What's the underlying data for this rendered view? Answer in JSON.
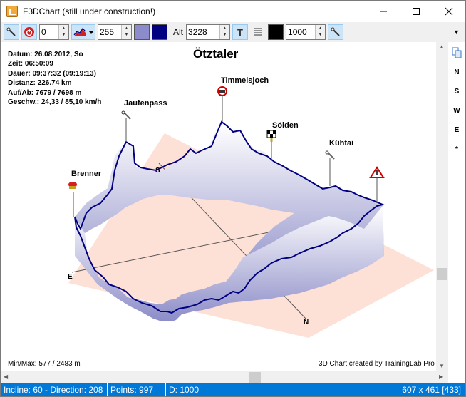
{
  "window": {
    "title": "F3DChart (still under construction!)",
    "minimize_icon": "minimize-icon",
    "maximize_icon": "maximize-icon",
    "close_icon": "close-icon"
  },
  "toolbar": {
    "button1_icon": "pointer-tool-icon",
    "button2_icon": "power-icon",
    "spin1_value": "0",
    "button3_icon": "line-chart-icon",
    "spin2_value": "255",
    "swatch1_color": "#8c8ccd",
    "swatch2_color": "#000080",
    "alt_label": "Alt",
    "spin3_value": "3228",
    "text_icon": "text-T-icon",
    "align_icon": "align-lines-icon",
    "swatch3_color": "#000000",
    "spin4_value": "1000",
    "button4_icon": "pointer-tool-icon"
  },
  "chart": {
    "title": "Ötztaler",
    "info": [
      "Datum: 26.08.2012, So",
      "Zeit: 06:50:09",
      "Dauer: 09:37:32 (09:19:13)",
      "Distanz: 226.74 km",
      "Auf/Ab: 7679 / 7698 m",
      "Geschw.: 24,33 / 85,10 km/h"
    ],
    "peaks": [
      "Timmelsjoch",
      "Jaufenpass",
      "Sölden",
      "Kühtai",
      "Brenner"
    ],
    "axis_labels": {
      "s": "S",
      "e": "E",
      "n": "N"
    },
    "minmax": "Min/Max: 577 / 2483 m",
    "credit": "3D Chart created by TrainingLab Pro",
    "ground_color": "#fde0d6",
    "line_color": "#000080"
  },
  "right_panel": {
    "copy_icon": "copy-icon",
    "items": [
      "N",
      "S",
      "W",
      "E",
      "*"
    ]
  },
  "statusbar": {
    "incline": "Incline: 60 - Direction: 208",
    "points": "Points: 997",
    "d": "D: 1000",
    "size": "607 x 461 [433]"
  }
}
